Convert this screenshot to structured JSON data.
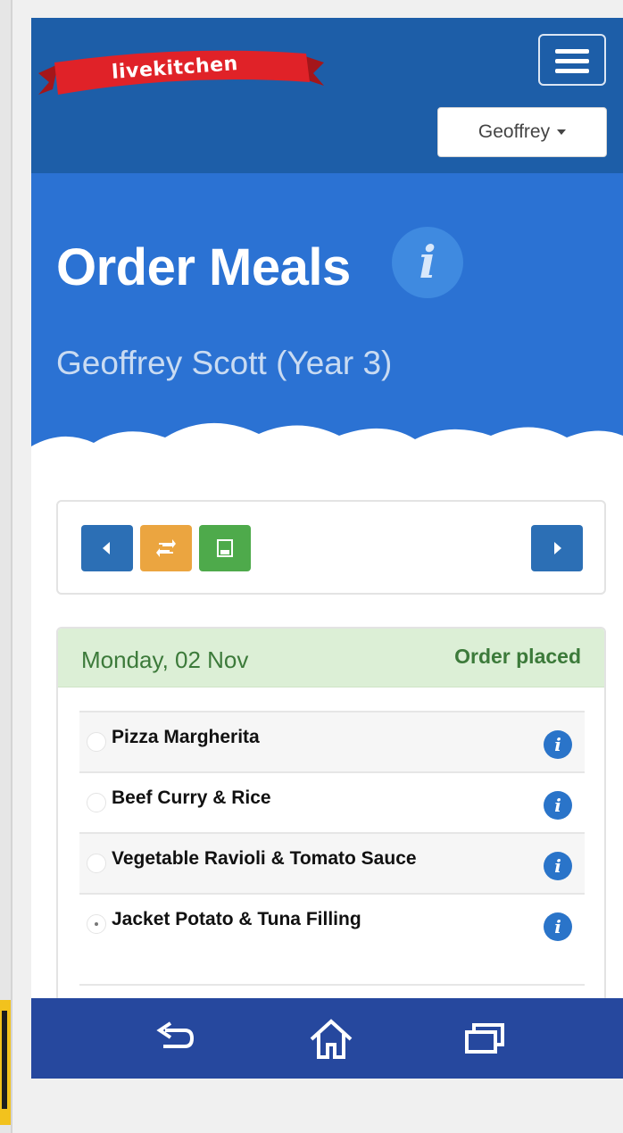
{
  "header": {
    "brand": "livekitchen",
    "user_menu_label": "Geoffrey",
    "menu_icon": "hamburger-icon"
  },
  "hero": {
    "title": "Order Meals",
    "info_glyph": "i",
    "subtitle": "Geoffrey Scott (Year 3)"
  },
  "toolbar": {
    "prev_icon": "chevron-left-icon",
    "repeat_icon": "repeat-icon",
    "save_icon": "save-icon",
    "next_icon": "chevron-right-icon"
  },
  "day": {
    "date": "Monday, 02 Nov",
    "status": "Order placed",
    "meals": [
      {
        "label": "Pizza Margherita",
        "selected": false,
        "info": "i"
      },
      {
        "label": "Beef Curry & Rice",
        "selected": false,
        "info": "i"
      },
      {
        "label": "Vegetable Ravioli & Tomato Sauce",
        "selected": false,
        "info": "i"
      },
      {
        "label": "Jacket Potato & Tuna Filling",
        "selected": true,
        "info": "i"
      }
    ]
  },
  "system_nav": {
    "back_icon": "back-icon",
    "home_icon": "home-icon",
    "recents_icon": "recents-icon"
  },
  "colors": {
    "header_blue": "#1d5ea8",
    "hero_blue": "#2b72d3",
    "banner_red": "#e02228",
    "prev_next_blue": "#2c6fb5",
    "repeat_orange": "#eba540",
    "save_green": "#4eaa4b",
    "status_green": "#3c7a3a",
    "nav_blue": "#26489e"
  }
}
